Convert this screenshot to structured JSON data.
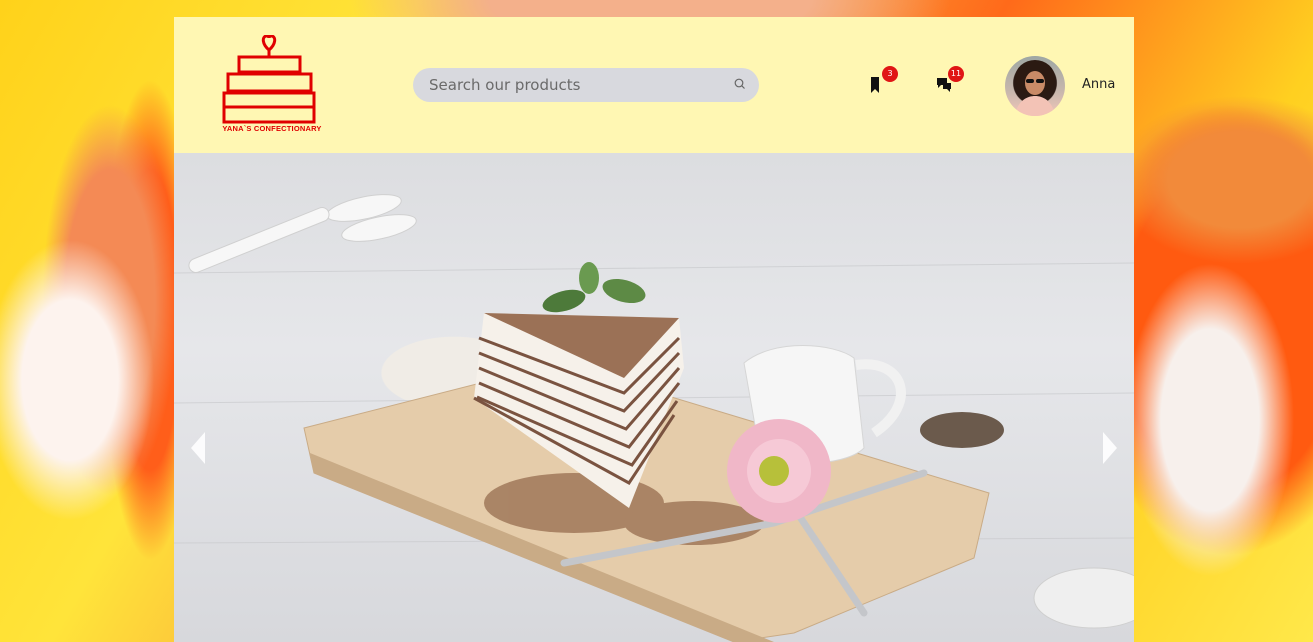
{
  "brand": {
    "name": "YANA`S CONFECTIONARY",
    "color": "#e00000"
  },
  "search": {
    "placeholder": "Search our products",
    "value": ""
  },
  "header": {
    "background": "#fff7b3",
    "bookmarks": {
      "icon": "bookmark-icon",
      "count": "3"
    },
    "messages": {
      "icon": "chat-icon",
      "count": "11"
    },
    "user": {
      "name": "Anna",
      "avatar": "avatar-photo"
    }
  },
  "carousel": {
    "image": "crepe cake slice on wooden board",
    "prev_icon": "chevron-left-icon",
    "next_icon": "chevron-right-icon"
  }
}
